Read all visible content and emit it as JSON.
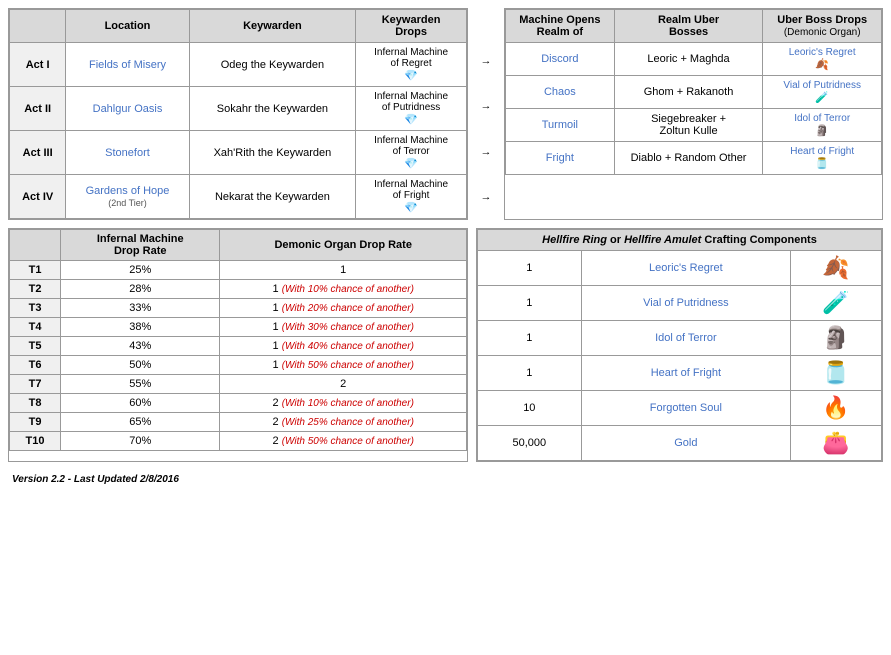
{
  "leftTopTable": {
    "headers": [
      "Location",
      "Keywarden",
      "Keywarden Drops"
    ],
    "rows": [
      {
        "act": "Act I",
        "location": "Fields of Misery",
        "keywarden": "Odeg the Keywarden",
        "machine": "Infernal Machine of Regret",
        "icon": "gem"
      },
      {
        "act": "Act II",
        "location": "Dahlgur Oasis",
        "keywarden": "Sokahr the Keywarden",
        "machine": "Infernal Machine of Putridness",
        "icon": "gem"
      },
      {
        "act": "Act III",
        "location": "Stonefort",
        "keywarden": "Xah'Rith the Keywarden",
        "machine": "Infernal Machine of Terror",
        "icon": "gem"
      },
      {
        "act": "Act IV",
        "location": "Gardens of Hope",
        "locationNote": "(2nd Tier)",
        "keywarden": "Nekarat the Keywarden",
        "machine": "Infernal Machine of Fright",
        "icon": "gem"
      }
    ]
  },
  "rightTopTable": {
    "headers": [
      "Machine Opens Realm of",
      "Realm Uber Bosses",
      "Uber Boss Drops (Demonic Organ)"
    ],
    "rows": [
      {
        "realm": "Discord",
        "bosses": "Leoric + Maghda",
        "drop": "Leoric's Regret",
        "icon": "leaves"
      },
      {
        "realm": "Chaos",
        "bosses": "Ghom + Rakanoth",
        "drop": "Vial of Putridness",
        "icon": "vial"
      },
      {
        "realm": "Turmoil",
        "bosses": "Siegebreaker + Zoltun Kulle",
        "drop": "Idol of Terror",
        "icon": "idol"
      },
      {
        "realm": "Fright",
        "bosses": "Diablo + Random Other",
        "drop": "Heart of Fright",
        "icon": "heart"
      }
    ]
  },
  "bottomLeftTable": {
    "col1Header": "Infernal Machine Drop Rate",
    "col2Header": "Demonic Organ Drop Rate",
    "rows": [
      {
        "tier": "T1",
        "dropRate": "25%",
        "organRate": "1",
        "note": ""
      },
      {
        "tier": "T2",
        "dropRate": "28%",
        "organRate": "1",
        "note": "(With 10% chance of another)"
      },
      {
        "tier": "T3",
        "dropRate": "33%",
        "organRate": "1",
        "note": "(With 20% chance of another)"
      },
      {
        "tier": "T4",
        "dropRate": "38%",
        "organRate": "1",
        "note": "(With 30% chance of another)"
      },
      {
        "tier": "T5",
        "dropRate": "43%",
        "organRate": "1",
        "note": "(With 40% chance of another)"
      },
      {
        "tier": "T6",
        "dropRate": "50%",
        "organRate": "1",
        "note": "(With 50% chance of another)"
      },
      {
        "tier": "T7",
        "dropRate": "55%",
        "organRate": "2",
        "note": ""
      },
      {
        "tier": "T8",
        "dropRate": "60%",
        "organRate": "2",
        "note": "(With 10% chance of another)"
      },
      {
        "tier": "T9",
        "dropRate": "65%",
        "organRate": "2",
        "note": "(With 25% chance of another)"
      },
      {
        "tier": "T10",
        "dropRate": "70%",
        "organRate": "2",
        "note": "(With 50% chance of another)"
      }
    ]
  },
  "bottomRightTable": {
    "header": "Hellfire Ring or Hellfire Amulet Crafting Components",
    "rows": [
      {
        "qty": "1",
        "item": "Leoric's Regret",
        "icon": "leaves"
      },
      {
        "qty": "1",
        "item": "Vial of Putridness",
        "icon": "vial"
      },
      {
        "qty": "1",
        "item": "Idol of Terror",
        "icon": "idol"
      },
      {
        "qty": "1",
        "item": "Heart of Fright",
        "icon": "heart"
      },
      {
        "qty": "10",
        "item": "Forgotten Soul",
        "icon": "soul"
      },
      {
        "qty": "50,000",
        "item": "Gold",
        "icon": "gold"
      }
    ]
  },
  "version": "Version 2.2 - Last Updated 2/8/2016",
  "icons": {
    "leaves": "🍂",
    "vial": "🧪",
    "idol": "🗿",
    "heart": "🫙",
    "soul": "🔥",
    "gold": "👛",
    "gem": "💎"
  }
}
